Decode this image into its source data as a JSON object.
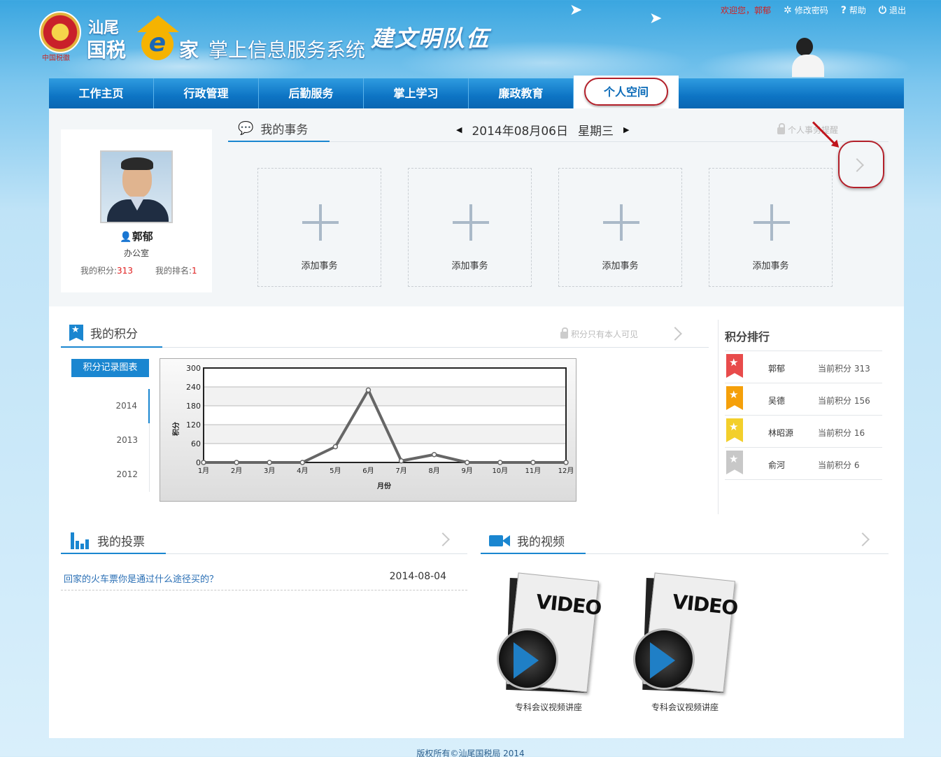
{
  "header": {
    "logo_small": "汕尾",
    "logo_big": "国税",
    "logo_e": "e",
    "logo_jia": "家",
    "system_name": "掌上信息服务系统",
    "slogan": "建文明队伍",
    "emblem_caption": "中国税徽"
  },
  "top_links": {
    "welcome": "欢迎您，郭郁",
    "change_password": "修改密码",
    "help": "帮助",
    "logout": "退出"
  },
  "nav": {
    "tabs": [
      {
        "label": "工作主页"
      },
      {
        "label": "行政管理"
      },
      {
        "label": "后勤服务"
      },
      {
        "label": "掌上学习"
      },
      {
        "label": "廉政教育"
      },
      {
        "label": "个人空间"
      }
    ]
  },
  "profile": {
    "name": "郭郁",
    "department": "办公室",
    "points_label": "我的积分:",
    "points": "313",
    "rank_label": "我的排名:",
    "rank": "1"
  },
  "affairs": {
    "title": "我的事务",
    "date": "2014年08月06日",
    "weekday": "星期三",
    "reminder": "个人事务提醒",
    "cards": [
      {
        "label": "添加事务"
      },
      {
        "label": "添加事务"
      },
      {
        "label": "添加事务"
      },
      {
        "label": "添加事务"
      }
    ]
  },
  "points": {
    "title": "我的积分",
    "note": "积分只有本人可见",
    "record_button": "积分记录图表",
    "years": [
      "2014",
      "2013",
      "2012"
    ]
  },
  "chart_data": {
    "type": "line",
    "categories": [
      "1月",
      "2月",
      "3月",
      "4月",
      "5月",
      "6月",
      "7月",
      "8月",
      "9月",
      "10月",
      "11月",
      "12月"
    ],
    "values": [
      0,
      0,
      0,
      0,
      50,
      230,
      5,
      25,
      0,
      0,
      0,
      0
    ],
    "xlabel": "月份",
    "ylabel": "积分",
    "ylim": [
      0,
      300
    ],
    "yticks": [
      "0",
      "60",
      "120",
      "180",
      "240",
      "300"
    ],
    "grid": true
  },
  "ranking": {
    "title": "积分排行",
    "rows": [
      {
        "name": "郭郁",
        "score": "当前积分 313",
        "color": "#e84b4b"
      },
      {
        "name": "吴德",
        "score": "当前积分 156",
        "color": "#f5a00a"
      },
      {
        "name": "林昭源",
        "score": "当前积分 16",
        "color": "#f3cf2b"
      },
      {
        "name": "俞河",
        "score": "当前积分 6",
        "color": "#c8c8c8"
      }
    ]
  },
  "vote": {
    "title": "我的投票",
    "items": [
      {
        "question": "回家的火车票你是通过什么途径买的？",
        "date": "2014-08-04"
      }
    ]
  },
  "video": {
    "title": "我的视频",
    "items": [
      {
        "badge": "VIDEO",
        "caption": "专科会议视频讲座"
      },
      {
        "badge": "VIDEO",
        "caption": "专科会议视频讲座"
      }
    ]
  },
  "footer": {
    "text": "版权所有©汕尾国税局 2014"
  },
  "colors": {
    "nav_blue": "#0d74c4",
    "accent": "#1a86d0",
    "highlight_red": "#b3202a"
  }
}
